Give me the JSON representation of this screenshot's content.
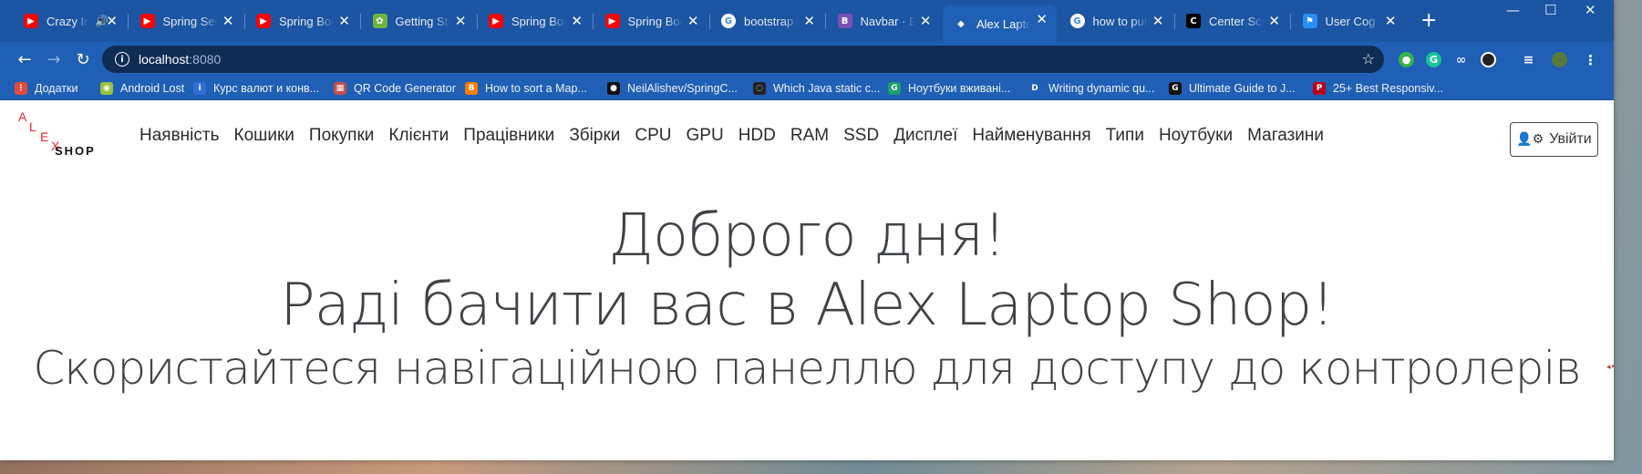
{
  "tabs": [
    {
      "title": "Crazy In",
      "favicon": "youtube-music-icon",
      "color": "#ff0000"
    },
    {
      "title": "Spring Secu",
      "favicon": "youtube-icon",
      "color": "#ff0000"
    },
    {
      "title": "Spring Boot",
      "favicon": "youtube-icon",
      "color": "#ff0000"
    },
    {
      "title": "Getting Star",
      "favicon": "spring-leaf-icon",
      "color": "#6db33f"
    },
    {
      "title": "Spring Boot",
      "favicon": "youtube-icon",
      "color": "#ff0000"
    },
    {
      "title": "Spring Boot",
      "favicon": "youtube-icon",
      "color": "#ff0000"
    },
    {
      "title": "bootstrap n",
      "favicon": "google-icon",
      "color": "#ffffff"
    },
    {
      "title": "Navbar · Bo",
      "favicon": "bootstrap-icon",
      "color": "#7952b3"
    },
    {
      "title": "Alex Laptop",
      "favicon": "app-icon",
      "color": "#1f5fb5"
    },
    {
      "title": "how to put",
      "favicon": "google-icon",
      "color": "#ffffff"
    },
    {
      "title": "Center Scre",
      "favicon": "c-icon",
      "color": "#000000"
    },
    {
      "title": "User Cog Ic",
      "favicon": "flag-icon",
      "color": "#2a8df2"
    }
  ],
  "address": {
    "host": "localhost",
    "port": ":8080"
  },
  "bookmarks": [
    {
      "label": "Додатки",
      "icon": "apps-grid-icon",
      "color": "#e04a3a"
    },
    {
      "label": "Android Lost",
      "icon": "android-icon",
      "color": "#9ac23c"
    },
    {
      "label": "Курс валют и конв...",
      "icon": "info-icon",
      "color": "#2f6fd6"
    },
    {
      "label": "QR Code Generator",
      "icon": "qr-icon",
      "color": "#c0504d"
    },
    {
      "label": "How to sort a Map...",
      "icon": "blogger-icon",
      "color": "#f57d00"
    },
    {
      "label": "NeilAlishev/SpringC...",
      "icon": "github-icon",
      "color": "#111111"
    },
    {
      "label": "Which Java static c...",
      "icon": "circle-dots-icon",
      "color": "#222222"
    },
    {
      "label": "Ноутбуки вживані...",
      "icon": "g-icon",
      "color": "#1aa06d"
    },
    {
      "label": "Writing dynamic qu...",
      "icon": "d-icon",
      "color": "#1f5fb5"
    },
    {
      "label": "Ultimate Guide to J...",
      "icon": "g-dark-icon",
      "color": "#111111"
    },
    {
      "label": "25+ Best Responsiv...",
      "icon": "pinterest-icon",
      "color": "#b8001a"
    }
  ],
  "brand": {
    "letters": [
      "A",
      "L",
      "E",
      "X"
    ],
    "shop": "SHOP"
  },
  "nav": [
    "Наявність",
    "Кошики",
    "Покупки",
    "Клієнти",
    "Працівники",
    "Збірки",
    "CPU",
    "GPU",
    "HDD",
    "RAM",
    "SSD",
    "Дисплеї",
    "Найменування",
    "Типи",
    "Ноутбуки",
    "Магазини"
  ],
  "login": {
    "label": "Увійти",
    "icon": "user-cog-icon"
  },
  "hero": {
    "line1": "Доброго дня!",
    "line2": "Раді бачити вас в Alex Laptop Shop!",
    "line3": "Скористайтеся навігаційною панеллю для доступу до контролерів"
  }
}
